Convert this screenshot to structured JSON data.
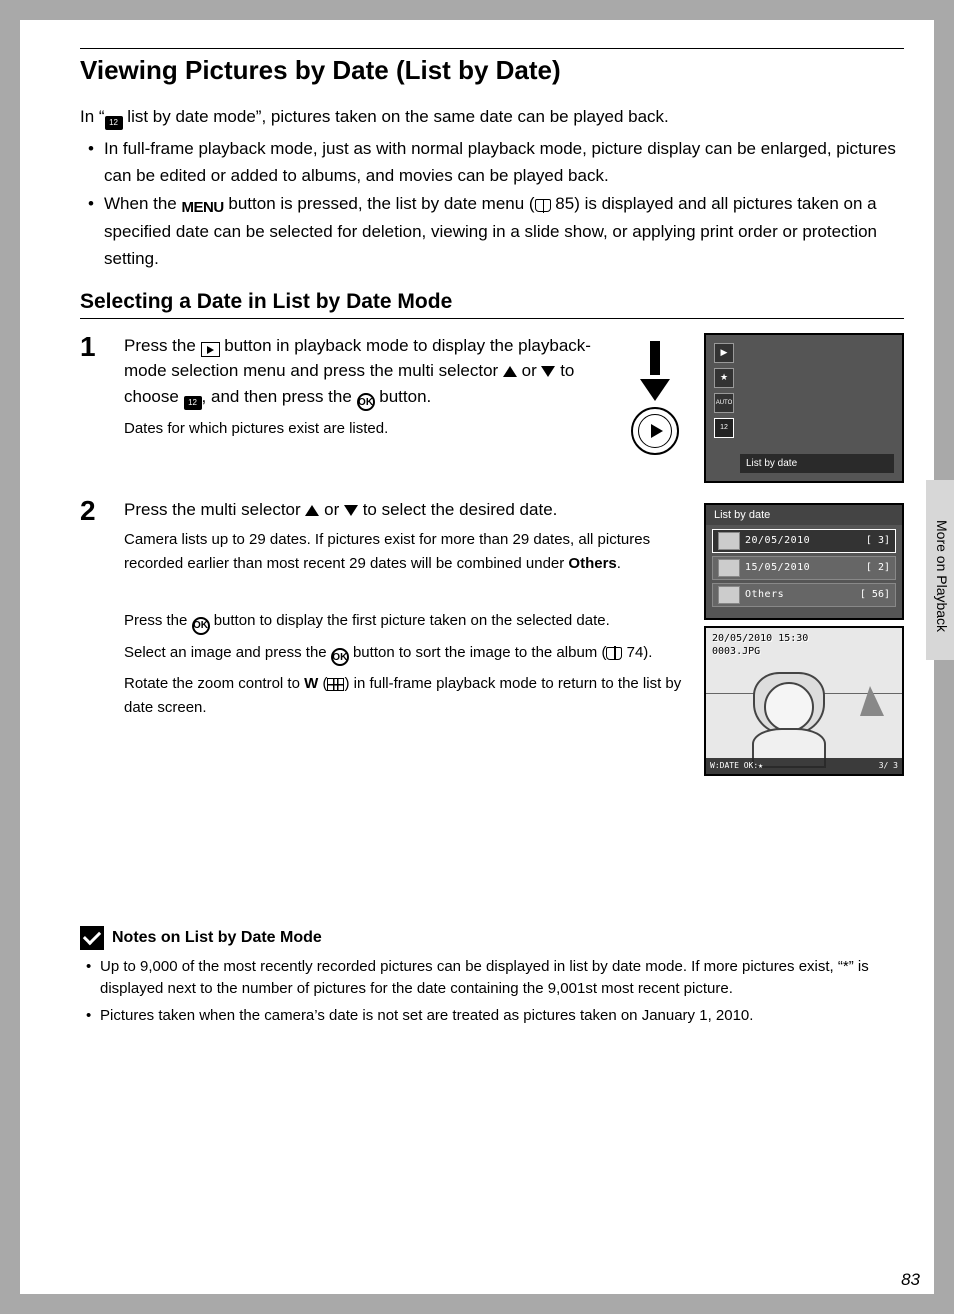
{
  "title": "Viewing Pictures by Date (List by Date)",
  "intro_pre": "In “",
  "intro_post": " list by date mode”, pictures taken on the same date can be played back.",
  "bullets": [
    "In full-frame playback mode, just as with normal playback mode, picture display can be enlarged, pictures can be edited or added to albums, and movies can be played back.",
    ""
  ],
  "bullet2_a": "When the ",
  "bullet2_b": " button is pressed, the list by date menu (",
  "bullet2_c": " 85) is displayed and all pictures taken on a specified date can be selected for deletion, viewing in a slide show, or applying print order or protection setting.",
  "subhead": "Selecting a Date in List by Date Mode",
  "step1_a": "Press the ",
  "step1_b": " button in playback mode to display the playback-mode selection menu and press the multi selector ",
  "step1_c": " or ",
  "step1_d": " to choose ",
  "step1_e": ", and then press the ",
  "step1_f": " button.",
  "step1_note": "Dates for which pictures exist are listed.",
  "step2_a": "Press the multi selector ",
  "step2_b": " or ",
  "step2_c": " to select the desired date.",
  "step2_note_a": "Camera lists up to 29 dates. If pictures exist for more than 29 dates, all pictures recorded earlier than most recent 29 dates will be combined under ",
  "step2_note_b": "Others",
  "step2_note_c": ".",
  "step2_p2_a": "Press the ",
  "step2_p2_b": " button to display the first picture taken on the selected date.",
  "step2_p3_a": "Select an image and press the ",
  "step2_p3_b": " button to sort the image to the album (",
  "step2_p3_c": " 74).",
  "step2_p4_a": "Rotate the zoom control to ",
  "step2_p4_w": "W",
  "step2_p4_b": " (",
  "step2_p4_c": ") in full-frame playback mode to return to the list by date screen.",
  "lcd": {
    "menu_label": "List by date",
    "list_header": "List by date",
    "rows": [
      {
        "date": "20/05/2010",
        "count": "3"
      },
      {
        "date": "15/05/2010",
        "count": "2"
      },
      {
        "date": "Others",
        "count": "56"
      }
    ],
    "photo_ts": "20/05/2010 15:30",
    "photo_file": "0003.JPG",
    "photo_index": "3/   3"
  },
  "notes": {
    "head": "Notes on List by Date Mode",
    "items": [
      "Up to 9,000 of the most recently recorded pictures can be displayed in list by date mode. If more pictures exist, “*” is displayed next to the number of pictures for the date containing the 9,001st most recent picture.",
      "Pictures taken when the camera’s date is not set are treated as pictures taken on January 1, 2010."
    ]
  },
  "side": "More on Playback",
  "page": "83",
  "glyph": {
    "menu": "MENU",
    "ok": "OK",
    "cal12": "12"
  }
}
